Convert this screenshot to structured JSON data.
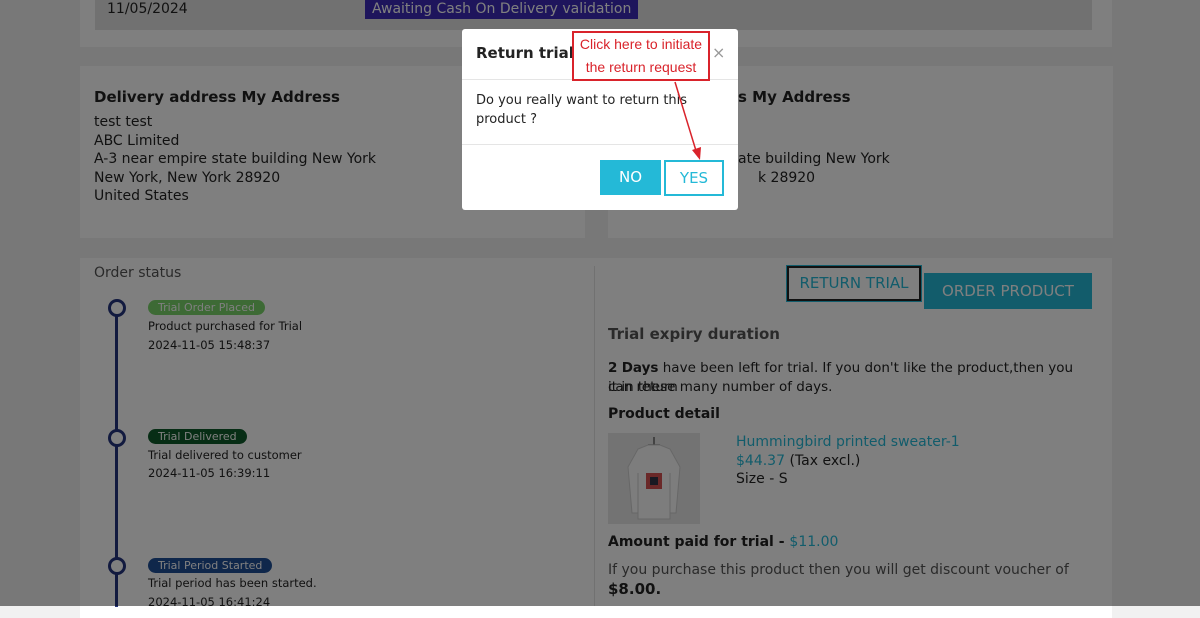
{
  "top_row": {
    "date": "11/05/2024",
    "status": "Awaiting Cash On Delivery validation"
  },
  "delivery": {
    "title": "Delivery address My Address",
    "lines": [
      "test test",
      "ABC Limited",
      "A-3 near empire state building New York",
      "New York, New York 28920",
      "United States"
    ]
  },
  "invoice": {
    "title_partial": "s My Address",
    "line3_partial": "ate building New York",
    "line4_partial": "k 28920"
  },
  "order_status": {
    "title": "Order status",
    "events": [
      {
        "badge": "Trial Order Placed",
        "color": "#7bd56a",
        "desc": "Product purchased for Trial",
        "time": "2024-11-05 15:48:37"
      },
      {
        "badge": "Trial Delivered",
        "color": "#0e5b2a",
        "desc": "Trial delivered to customer",
        "time": "2024-11-05 16:39:11"
      },
      {
        "badge": "Trial Period Started",
        "color": "#1f4e97",
        "desc": "Trial period has been started.",
        "time": "2024-11-05 16:41:24"
      }
    ]
  },
  "actions": {
    "return_trial": "RETURN TRIAL",
    "order_product": "ORDER PRODUCT"
  },
  "trial": {
    "expiry_title": "Trial expiry duration",
    "days": "2",
    "days_label": "Days",
    "expiry_text_1": " have been left for trial. If you don't like the product,then you can return",
    "expiry_text_2": "it in these many number of days.",
    "product_detail_title": "Product detail",
    "product_name": "Hummingbird printed sweater-1",
    "price": "$44.37",
    "tax_note": "(Tax excl.)",
    "size": "Size - S",
    "amount_label": "Amount paid for trial - ",
    "amount_value": "$11.00",
    "voucher_text": "If you purchase this product then you will get discount voucher of",
    "voucher_value": "$8.00."
  },
  "modal": {
    "title": "Return trial",
    "close": "×",
    "message_1": "Do you really want to return this",
    "message_2": "product ?",
    "no_label": "NO",
    "yes_label": "YES"
  },
  "callout": {
    "line1": "Click here to initiate",
    "line2": "the return request"
  },
  "colors": {
    "accent": "#24b9d7",
    "overlay": "rgba(0,0,0,0.5)",
    "callout": "#d9232b"
  }
}
